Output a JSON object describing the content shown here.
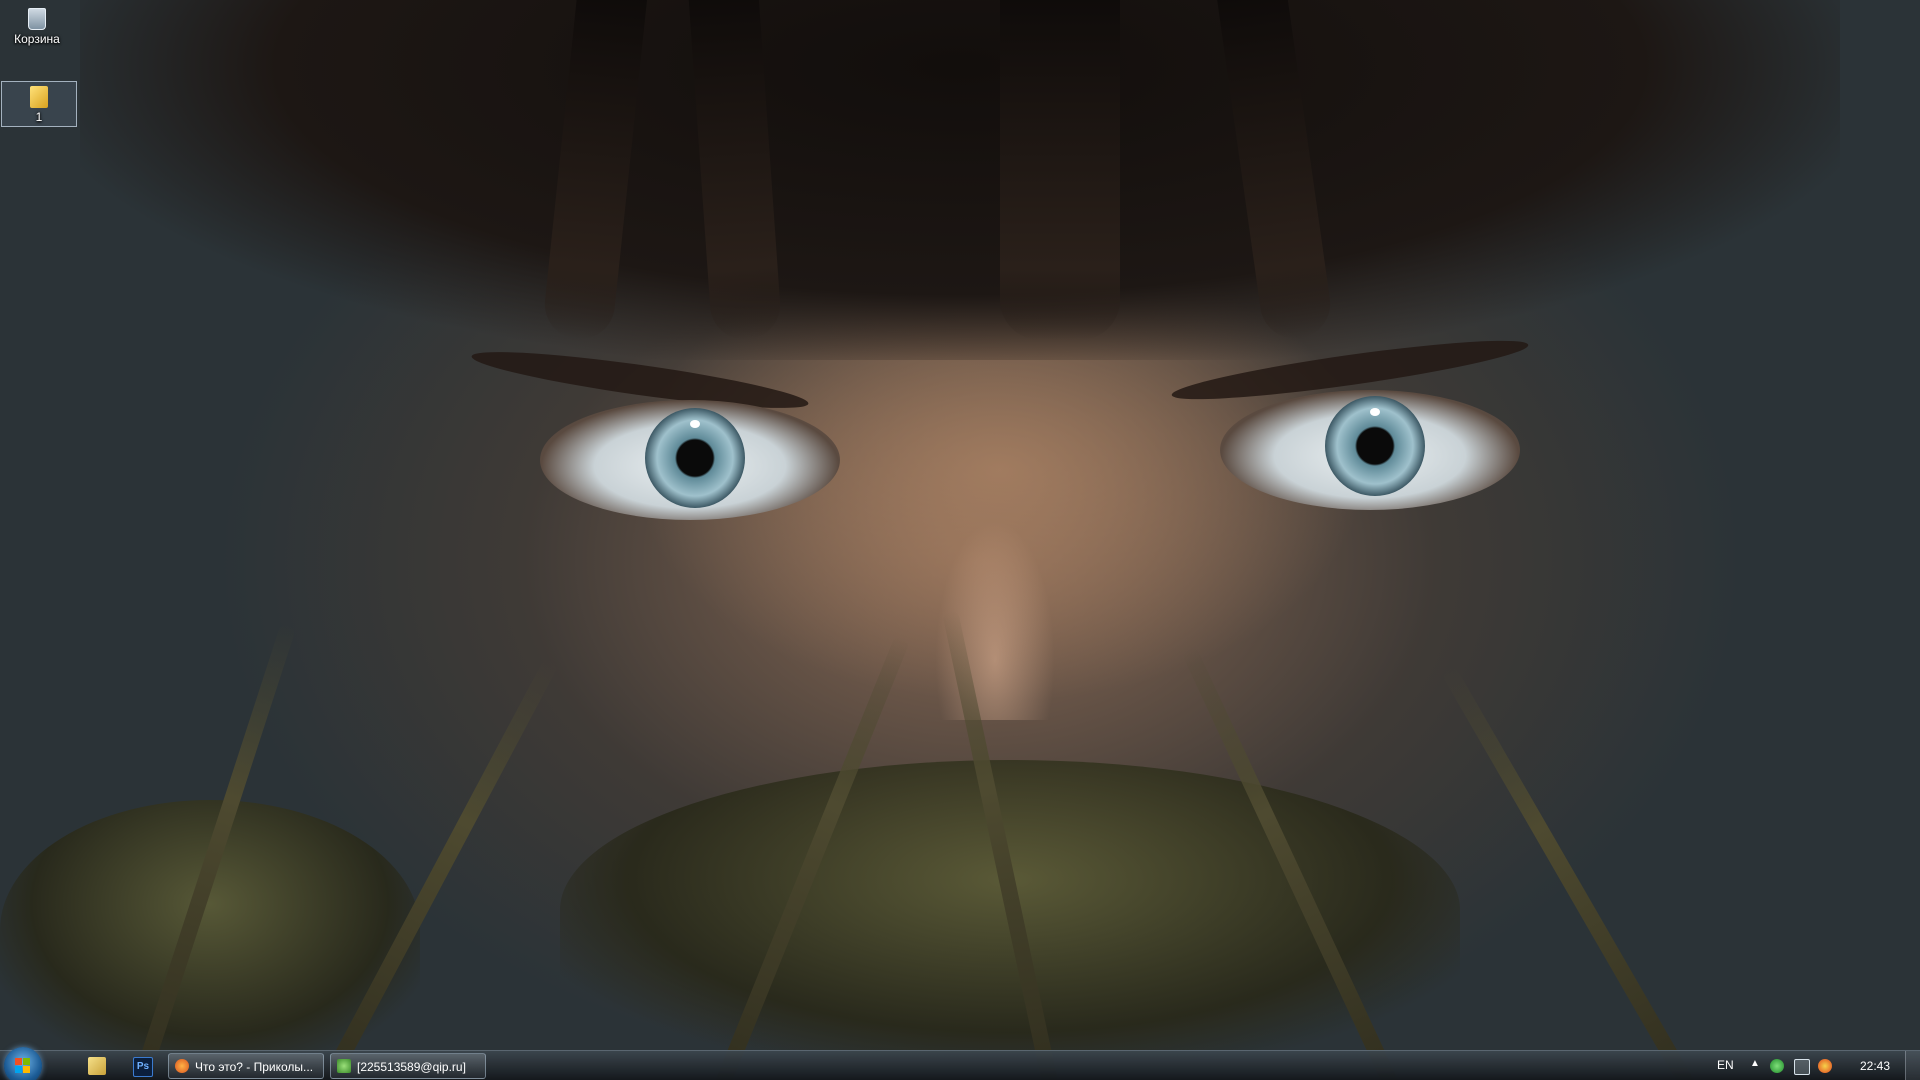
{
  "desktop": {
    "icons": [
      {
        "label": "Корзина",
        "icon": "recycle-bin-icon"
      },
      {
        "label": "1",
        "icon": "folder-icon"
      }
    ]
  },
  "taskbar": {
    "start": {
      "icon": "windows-start-icon"
    },
    "quick_launch": [
      {
        "icon": "explorer-icon"
      },
      {
        "icon": "photoshop-icon",
        "text": "Ps"
      }
    ],
    "tasks": [
      {
        "label": "Что это? - Приколы...",
        "icon": "firefox-icon"
      },
      {
        "label": "[225513589@qip.ru]",
        "icon": "qip-icon"
      }
    ],
    "tray": {
      "language": "EN",
      "expand": "▲",
      "icons": [
        "network-status-icon",
        "network-icon",
        "qip-tray-icon"
      ],
      "clock": "22:43"
    }
  }
}
